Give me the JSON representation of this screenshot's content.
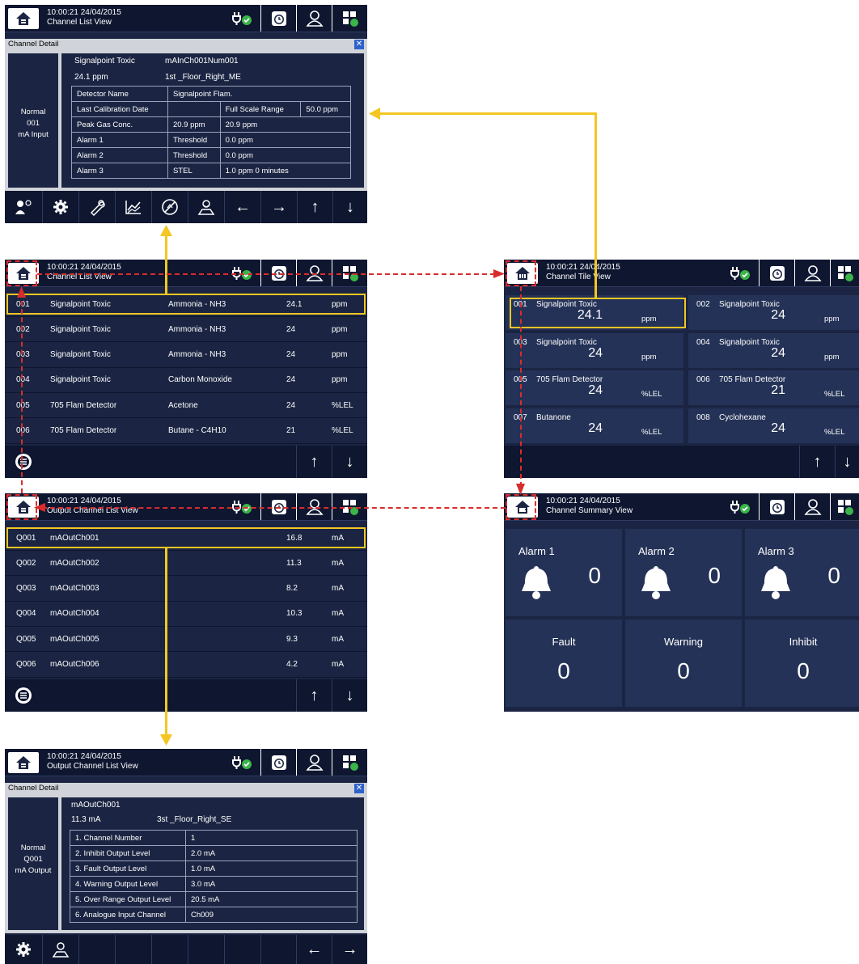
{
  "datetime": "10:00:21 24/04/2015",
  "views": {
    "channel_list": "Channel List View",
    "channel_tile": "Channel Tile View",
    "channel_summary": "Channel Summary View",
    "output_channel_list": "Output Channel List View"
  },
  "channel_detail": {
    "title": "Channel Detail",
    "close": "✕",
    "status": "Normal",
    "num": "001",
    "type": "mA Input",
    "sensor": "Signalpoint Toxic",
    "tag": "mAInCh001Num001",
    "reading": "24.1 ppm",
    "location": "1st _Floor_Right_ME",
    "rows": [
      [
        "Detector Name",
        "Signalpoint Flam.",
        "",
        ""
      ],
      [
        "Last Calibration Date",
        "",
        "Full Scale Range",
        "50.0 ppm"
      ],
      [
        "Peak Gas Conc.",
        "20.9 ppm",
        "20.9 ppm",
        ""
      ],
      [
        "Alarm 1",
        "Threshold",
        "0.0 ppm",
        ""
      ],
      [
        "Alarm 2",
        "Threshold",
        "0.0 ppm",
        ""
      ],
      [
        "Alarm 3",
        "STEL",
        "1.0 ppm   0 minutes",
        ""
      ]
    ]
  },
  "channel_list": [
    [
      "001",
      "Signalpoint Toxic",
      "Ammonia - NH3",
      "24.1",
      "ppm"
    ],
    [
      "002",
      "Signalpoint Toxic",
      "Ammonia - NH3",
      "24",
      "ppm"
    ],
    [
      "003",
      "Signalpoint Toxic",
      "Ammonia - NH3",
      "24",
      "ppm"
    ],
    [
      "004",
      "Signalpoint Toxic",
      "Carbon Monoxide",
      "24",
      "ppm"
    ],
    [
      "005",
      "705 Flam Detector",
      "Acetone",
      "24",
      "%LEL"
    ],
    [
      "006",
      "705 Flam Detector",
      "Butane - C4H10",
      "21",
      "%LEL"
    ]
  ],
  "tiles": [
    [
      "001",
      "Signalpoint Toxic",
      "24.1",
      "ppm"
    ],
    [
      "002",
      "Signalpoint Toxic",
      "24",
      "ppm"
    ],
    [
      "003",
      "Signalpoint Toxic",
      "24",
      "ppm"
    ],
    [
      "004",
      "Signalpoint Toxic",
      "24",
      "ppm"
    ],
    [
      "005",
      "705 Flam Detector",
      "24",
      "%LEL"
    ],
    [
      "006",
      "705 Flam Detector",
      "21",
      "%LEL"
    ],
    [
      "007",
      "Butanone",
      "24",
      "%LEL"
    ],
    [
      "008",
      "Cyclohexane",
      "24",
      "%LEL"
    ]
  ],
  "summary": [
    [
      "Alarm 1",
      "0"
    ],
    [
      "Alarm 2",
      "0"
    ],
    [
      "Alarm 3",
      "0"
    ],
    [
      "Fault",
      "0"
    ],
    [
      "Warning",
      "0"
    ],
    [
      "Inhibit",
      "0"
    ]
  ],
  "output_list": [
    [
      "Q001",
      "mAOutCh001",
      "16.8",
      "mA"
    ],
    [
      "Q002",
      "mAOutCh002",
      "11.3",
      "mA"
    ],
    [
      "Q003",
      "mAOutCh003",
      "8.2",
      "mA"
    ],
    [
      "Q004",
      "mAOutCh004",
      "10.3",
      "mA"
    ],
    [
      "Q005",
      "mAOutCh005",
      "9.3",
      "mA"
    ],
    [
      "Q006",
      "mAOutCh006",
      "4.2",
      "mA"
    ]
  ],
  "output_detail": {
    "title": "Channel Detail",
    "close": "✕",
    "status": "Normal",
    "num": "Q001",
    "type": "mA Output",
    "tag": "mAOutCh001",
    "reading": "11.3 mA",
    "location": "3st _Floor_Right_SE",
    "rows": [
      [
        "1. Channel Number",
        "1"
      ],
      [
        "2. Inhibit Output Level",
        "2.0 mA"
      ],
      [
        "3. Fault Output Level",
        "1.0 mA"
      ],
      [
        "4. Warning Output Level",
        "3.0 mA"
      ],
      [
        "5. Over Range Output Level",
        "20.5 mA"
      ],
      [
        "6. Analogue Input Channel",
        "Ch009"
      ]
    ]
  },
  "nav": {
    "up": "↑",
    "down": "↓",
    "left": "←",
    "right": "→"
  },
  "colors": {
    "panel": "#1b2543",
    "header": "#0e1630",
    "highlight": "#f3c623",
    "link": "#d92c2c"
  }
}
